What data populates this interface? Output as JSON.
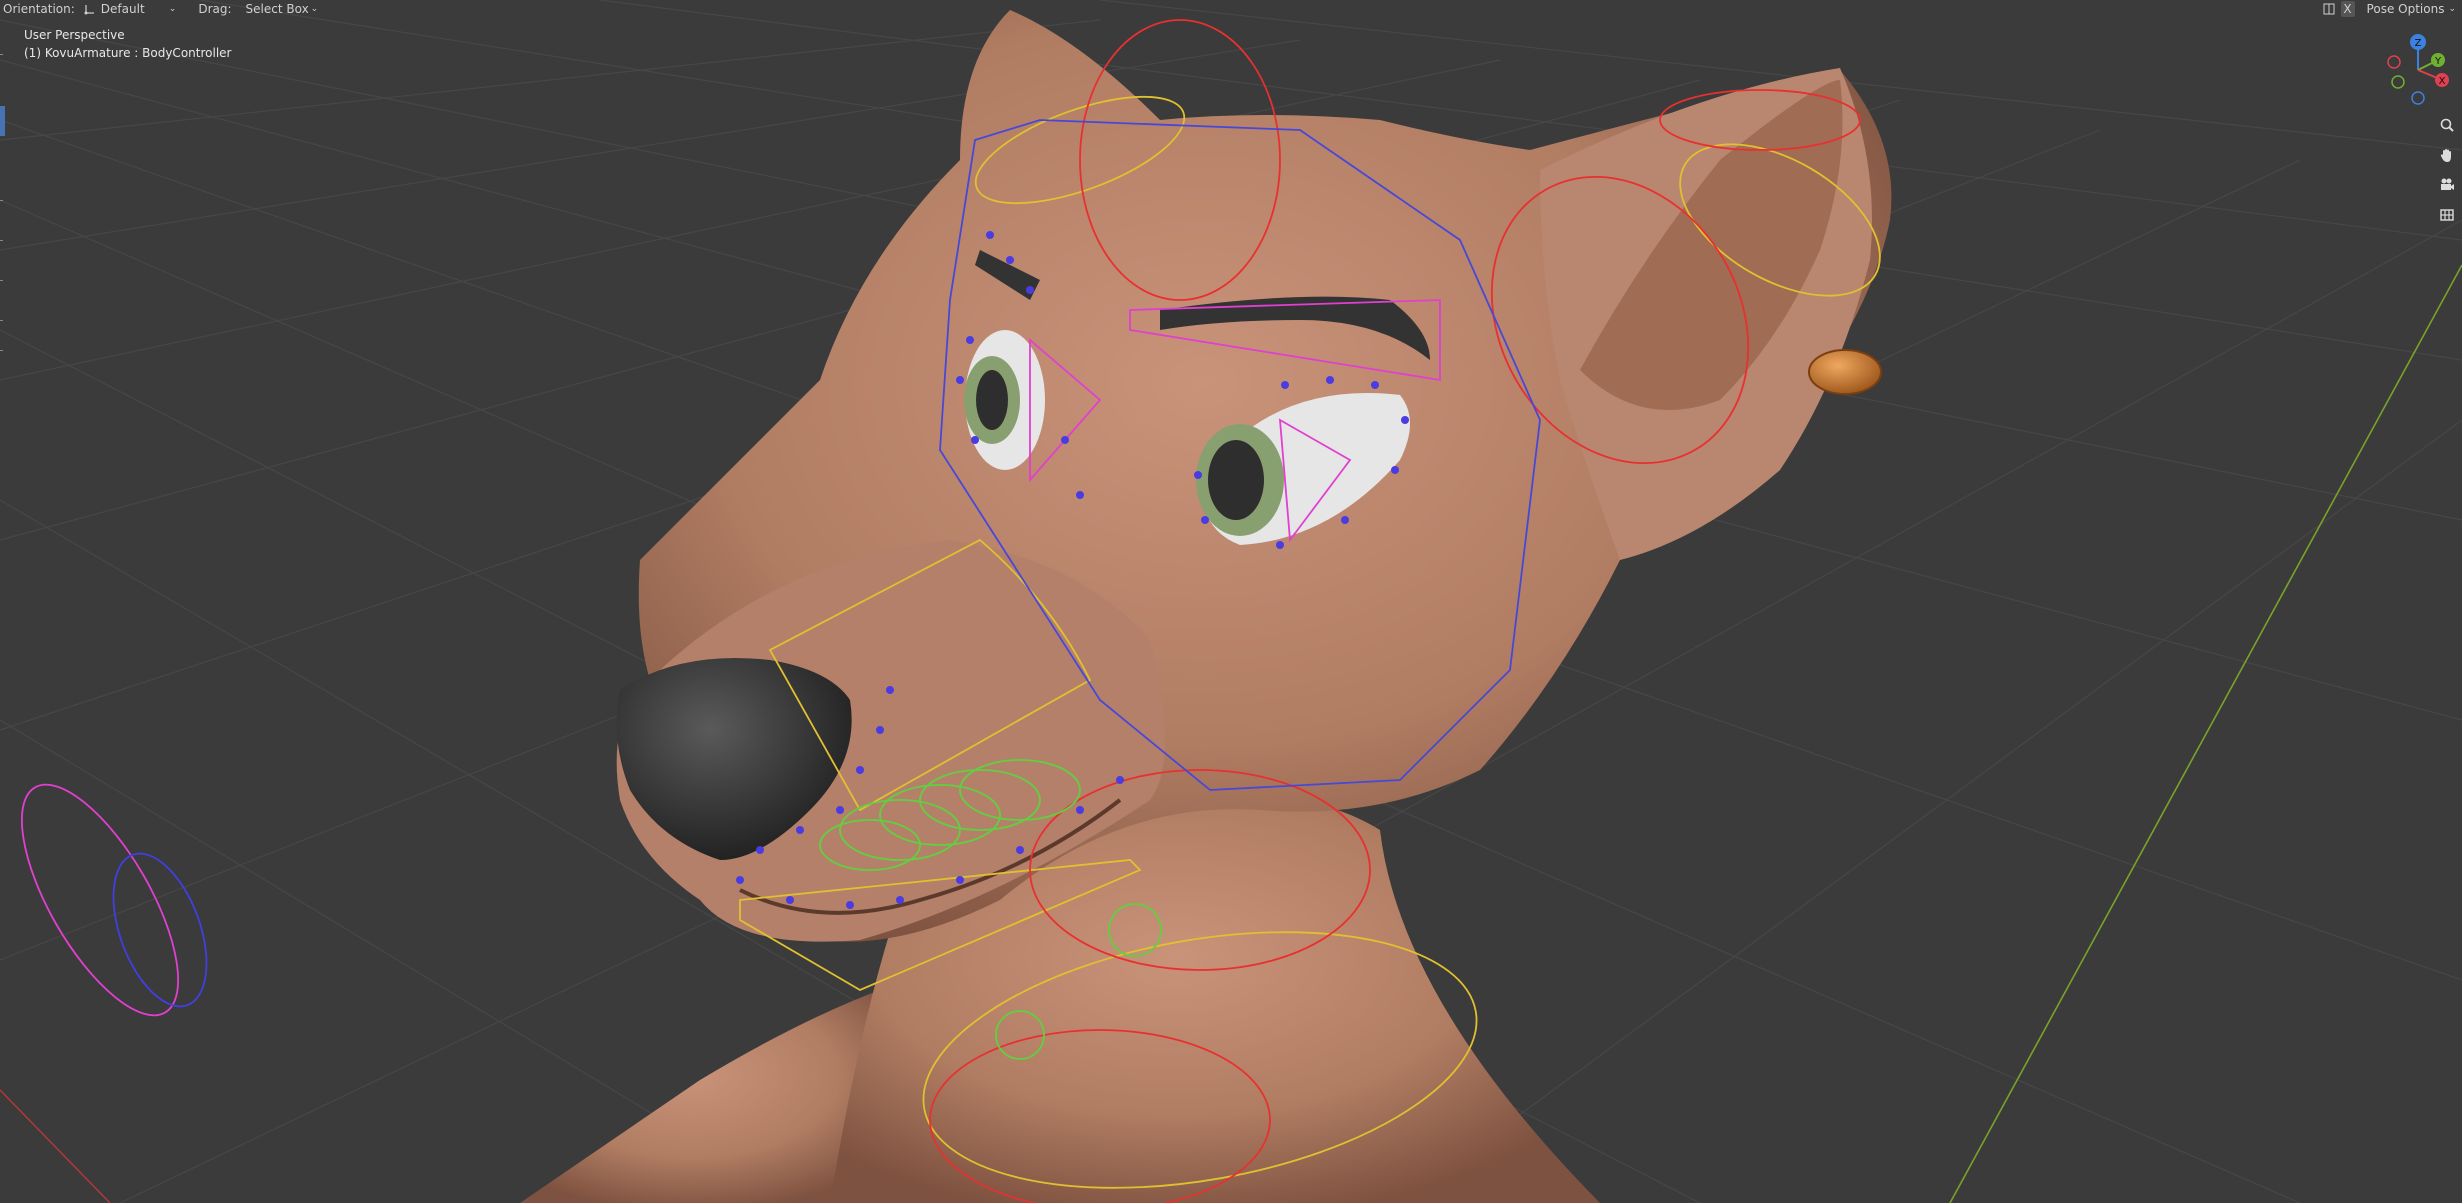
{
  "header": {
    "orientation_label": "Orientation:",
    "orientation_value": "Default",
    "drag_label": "Drag:",
    "drag_value": "Select Box",
    "x_label": "X",
    "pose_options_label": "Pose Options"
  },
  "viewport": {
    "view_name": "User Perspective",
    "active_object": "(1) KovuArmature : BodyController"
  },
  "gizmo": {
    "z_label": "Z",
    "y_label": "Y",
    "x_label": "X",
    "axis_colors": {
      "x": "#e04050",
      "y": "#70b030",
      "z": "#3b82e0"
    }
  },
  "nav_tools": [
    "zoom-icon",
    "hand-pan-icon",
    "camera-icon",
    "grid-ortho-icon"
  ],
  "colors": {
    "background": "#3b3b3b",
    "skin": "#b07c62",
    "bone_red": "#e83030",
    "bone_yellow": "#e0c030",
    "bone_magenta": "#e040d0",
    "bone_blue": "#4040e0",
    "bone_green": "#60d040",
    "accent": "#4772b3"
  }
}
